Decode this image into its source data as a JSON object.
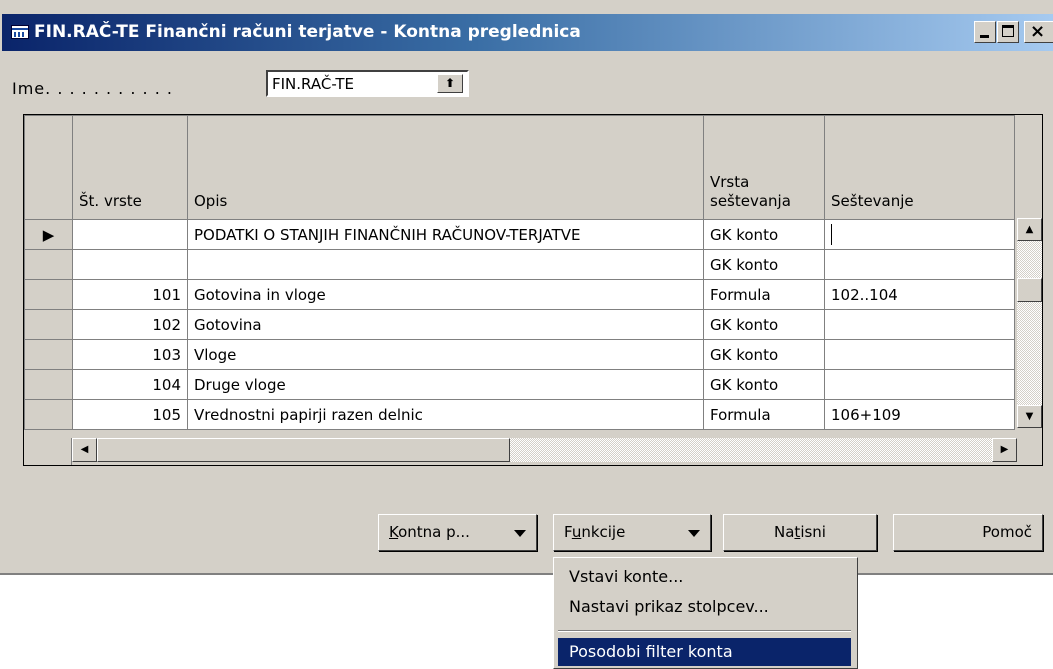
{
  "window": {
    "title": "FIN.RAČ-TE Finančni računi terjatve - Kontna preglednica"
  },
  "name_field": {
    "label": "Ime. . . . . . . . . . .",
    "value": "FIN.RAČ-TE"
  },
  "table": {
    "headers": {
      "row_no": "Št. vrste",
      "description": "Opis",
      "totaling_type": "Vrsta seštevanja",
      "totaling": "Seštevanje"
    },
    "rows": [
      {
        "row_no": "",
        "description": "PODATKI O STANJIH FINANČNIH RAČUNOV-TERJATVE",
        "totaling_type": "GK konto",
        "totaling": "",
        "current": true
      },
      {
        "row_no": "",
        "description": "",
        "totaling_type": "GK konto",
        "totaling": ""
      },
      {
        "row_no": "101",
        "description": "Gotovina in vloge",
        "totaling_type": "Formula",
        "totaling": "102..104"
      },
      {
        "row_no": "102",
        "description": "Gotovina",
        "totaling_type": "GK konto",
        "totaling": ""
      },
      {
        "row_no": "103",
        "description": "Vloge",
        "totaling_type": "GK konto",
        "totaling": ""
      },
      {
        "row_no": "104",
        "description": "Druge vloge",
        "totaling_type": "GK konto",
        "totaling": ""
      },
      {
        "row_no": "105",
        "description": "Vrednostni papirji razen delnic",
        "totaling_type": "Formula",
        "totaling": "106+109"
      }
    ]
  },
  "buttons": {
    "account_schedule": {
      "mnemonic": "K",
      "rest": "ontna p..."
    },
    "functions": {
      "before": "F",
      "mnemonic": "u",
      "after": "nkcije"
    },
    "print": {
      "before": "Na",
      "mnemonic": "t",
      "after": "isni"
    },
    "help": "Pomoč"
  },
  "functions_menu": {
    "items": [
      "Vstavi konte...",
      "Nastavi prikaz stolpcev...",
      "Posodobi filter konta"
    ],
    "highlighted": "Posodobi filter konta"
  },
  "colors": {
    "title_gradient_start": "#0a246a",
    "title_gradient_end": "#a6caf0",
    "window_face": "#d4d0c8",
    "menu_highlight": "#0a246a"
  }
}
